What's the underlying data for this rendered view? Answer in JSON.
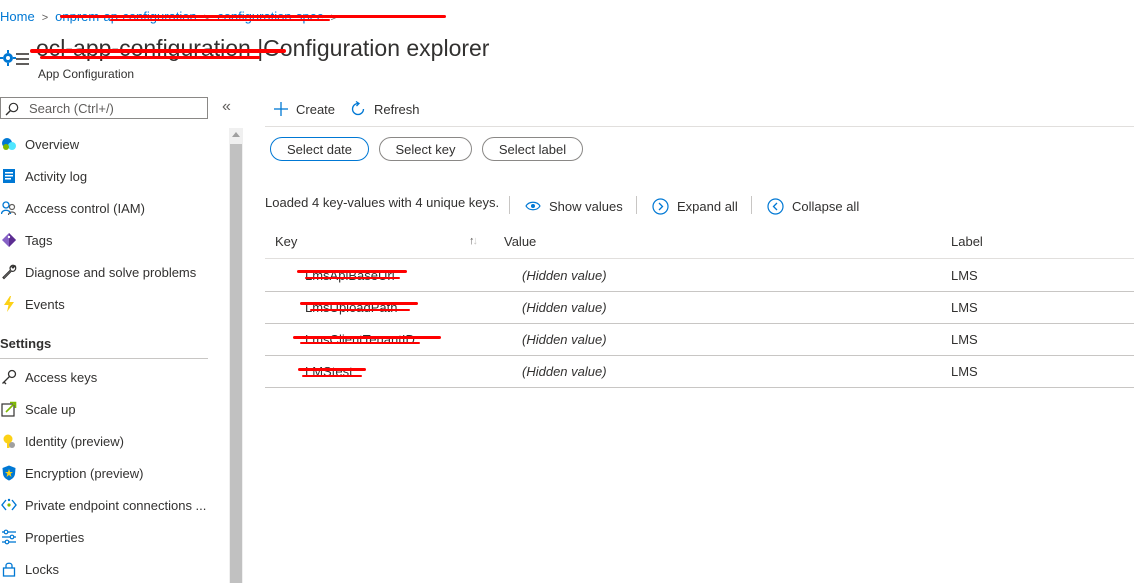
{
  "breadcrumb": {
    "home": "Home",
    "item2": "onprem-ap-configuration",
    "item3": "configuration-spec"
  },
  "header": {
    "resource_name": "ocl-app-configuration",
    "separator": "|",
    "blade_title": "Configuration explorer",
    "subtitle": "App Configuration"
  },
  "search": {
    "placeholder": "Search (Ctrl+/)"
  },
  "collapse_label": "«",
  "sidebar": {
    "items": [
      {
        "label": "Overview",
        "icon": "overview-icon"
      },
      {
        "label": "Activity log",
        "icon": "activity-log-icon"
      },
      {
        "label": "Access control (IAM)",
        "icon": "iam-icon"
      },
      {
        "label": "Tags",
        "icon": "tag-icon"
      },
      {
        "label": "Diagnose and solve problems",
        "icon": "wrench-icon"
      },
      {
        "label": "Events",
        "icon": "lightning-icon"
      }
    ],
    "settings_title": "Settings",
    "settings_items": [
      {
        "label": "Access keys",
        "icon": "key-icon"
      },
      {
        "label": "Scale up",
        "icon": "scale-up-icon"
      },
      {
        "label": "Identity (preview)",
        "icon": "identity-icon"
      },
      {
        "label": "Encryption (preview)",
        "icon": "shield-icon"
      },
      {
        "label": "Private endpoint connections ...",
        "icon": "private-endpoint-icon"
      },
      {
        "label": "Properties",
        "icon": "properties-icon"
      },
      {
        "label": "Locks",
        "icon": "lock-icon"
      }
    ]
  },
  "toolbar": {
    "create": "Create",
    "refresh": "Refresh"
  },
  "filters": {
    "date": "Select date",
    "key": "Select key",
    "label": "Select label"
  },
  "status": {
    "loaded_text": "Loaded 4 key-values with 4 unique keys.",
    "show_values": "Show values",
    "expand_all": "Expand all",
    "collapse_all": "Collapse all"
  },
  "table": {
    "columns": {
      "key": "Key",
      "value": "Value",
      "label": "Label"
    },
    "rows": [
      {
        "key": "LmsApiBaseUrl",
        "value": "(Hidden value)",
        "label": "LMS"
      },
      {
        "key": "LmsUploadPath",
        "value": "(Hidden value)",
        "label": "LMS"
      },
      {
        "key": "LmsClientTenantID",
        "value": "(Hidden value)",
        "label": "LMS"
      },
      {
        "key": "LMStest",
        "value": "(Hidden value)",
        "label": "LMS"
      }
    ]
  },
  "colors": {
    "accent": "#0078d4",
    "redaction": "#ff0000"
  }
}
